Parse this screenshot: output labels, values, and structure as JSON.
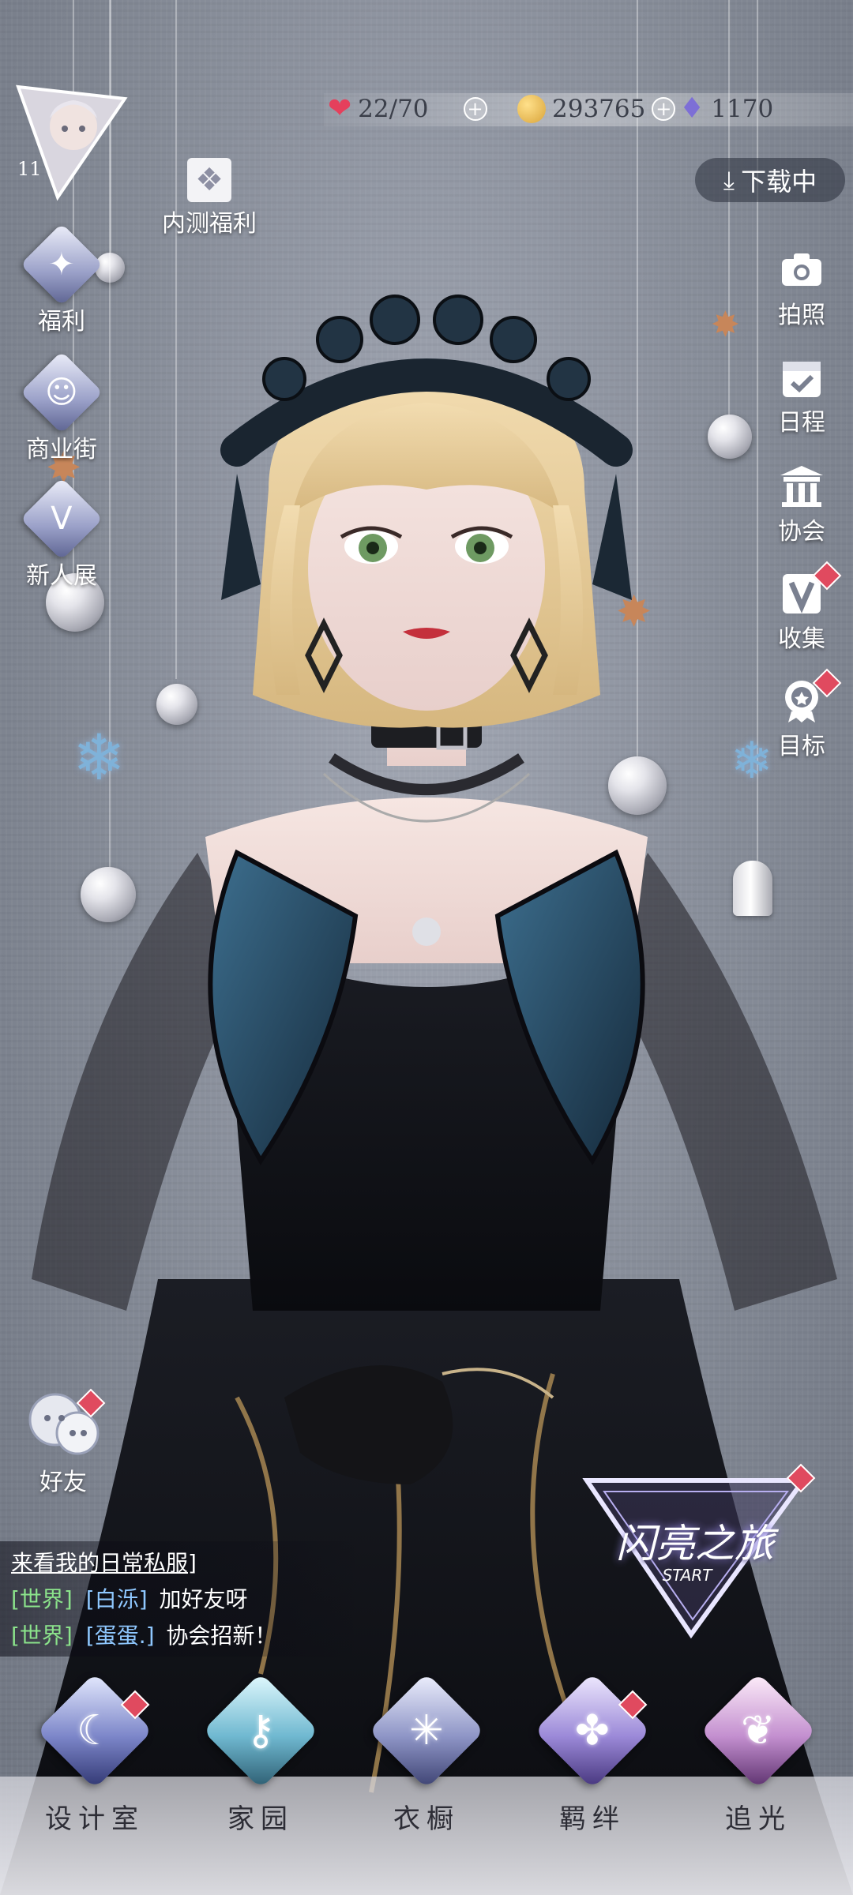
{
  "resources": {
    "stamina": {
      "value": "22/70",
      "icon": "heart-gem-icon"
    },
    "gold": {
      "value": "293765",
      "icon": "gold-coin-icon"
    },
    "diamond": {
      "value": "1170",
      "icon": "diamond-icon"
    }
  },
  "player": {
    "level": "11"
  },
  "left_menu": {
    "beta_gift": "内测福利",
    "welfare": "福利",
    "shop_street": "商业街",
    "newcomer_show": "新人展"
  },
  "download": {
    "label": "下载中"
  },
  "right_menu": {
    "photo": "拍照",
    "schedule": "日程",
    "guild": "协会",
    "collection": "收集",
    "goal": "目标"
  },
  "friends": {
    "label": "好友"
  },
  "chat": {
    "lines": [
      {
        "channel": "",
        "name": "",
        "text": "来看我的日常私服]"
      },
      {
        "channel": "[世界]",
        "name": "[白泺]",
        "text": "加好友呀"
      },
      {
        "channel": "[世界]",
        "name": "[蛋蛋.]",
        "text": "协会招新！"
      }
    ]
  },
  "journey_banner": {
    "title": "闪亮之旅",
    "start": "START"
  },
  "bottom_nav": [
    {
      "label": "设计室",
      "icon": "moon-icon"
    },
    {
      "label": "家园",
      "icon": "key-icon"
    },
    {
      "label": "衣橱",
      "icon": "crystal-icon"
    },
    {
      "label": "羁绊",
      "icon": "clover-icon"
    },
    {
      "label": "追光",
      "icon": "butterfly-icon"
    }
  ],
  "colors": {
    "badge": "#e04a5f",
    "world_tag": "#8be38b",
    "name_tag": "#8fc8ff"
  }
}
